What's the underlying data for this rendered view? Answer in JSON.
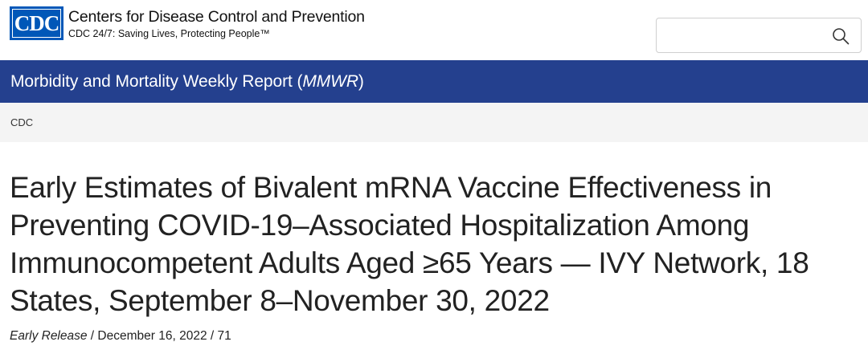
{
  "header": {
    "logo_text": "CDC",
    "org_name": "Centers for Disease Control and Prevention",
    "tagline": "CDC 24/7: Saving Lives, Protecting People™",
    "search": {
      "value": "",
      "placeholder": ""
    },
    "search_icon": "search-icon"
  },
  "banner": {
    "title_prefix": "Morbidity and Mortality Weekly Report (",
    "title_abbrev": "MMWR",
    "title_suffix": ")",
    "background_color": "#24408e"
  },
  "breadcrumb": {
    "items": [
      "CDC"
    ]
  },
  "article": {
    "title": "Early Estimates of Bivalent mRNA Vaccine Effectiveness in Preventing COVID-19–Associated Hospitalization Among Immunocompetent Adults Aged ≥65 Years — IVY Network, 18 States, September 8–November 30, 2022",
    "release_type": "Early Release",
    "date": "December 16, 2022",
    "volume": "71",
    "separator": " / "
  },
  "colors": {
    "brand_blue": "#0057b8",
    "banner_blue": "#24408e",
    "breadcrumb_bg": "#f4f4f4"
  }
}
